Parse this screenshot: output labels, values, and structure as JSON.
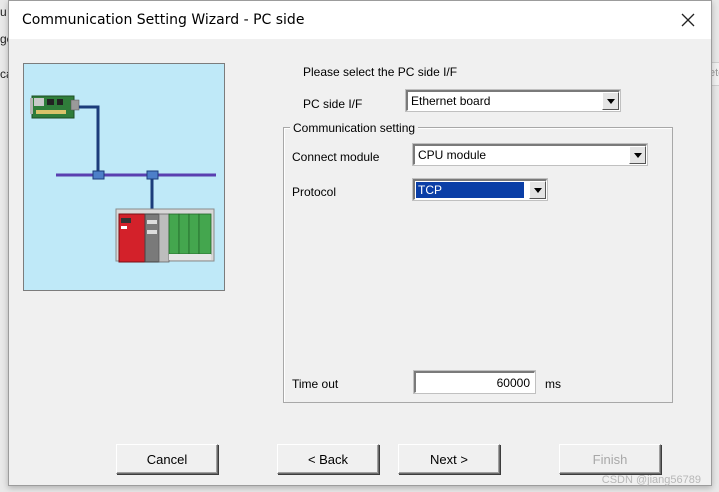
{
  "background": {
    "fragments": [
      "u",
      "ge",
      "ca",
      "ete"
    ]
  },
  "dialog": {
    "title": "Communication Setting Wizard - PC side",
    "prompt": "Please select the PC side I/F",
    "pc_side_if": {
      "label": "PC side I/F",
      "value": "Ethernet board"
    },
    "communication_setting": {
      "title": "Communication setting",
      "connect_module": {
        "label": "Connect module",
        "value": "CPU module"
      },
      "protocol": {
        "label": "Protocol",
        "value": "TCP"
      },
      "timeout": {
        "label": "Time out",
        "value": "60000",
        "unit": "ms"
      }
    },
    "buttons": {
      "cancel": "Cancel",
      "back": "< Back",
      "next": "Next >",
      "finish": "Finish"
    },
    "watermark": "CSDN @jiang56789"
  },
  "colors": {
    "illustration_bg": "#bfe9f8",
    "network_line": "#1b3c7a",
    "bus_line": "#5a3fb0",
    "selection": "#0a3ea6"
  }
}
